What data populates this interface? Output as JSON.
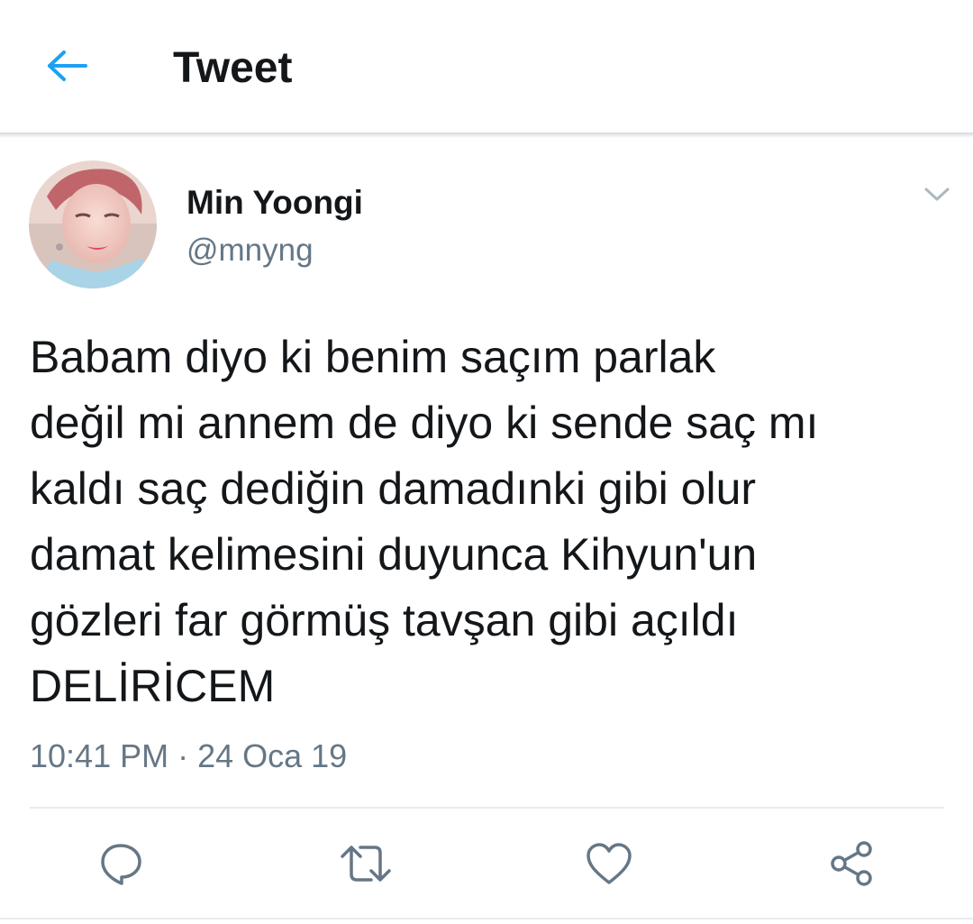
{
  "appbar": {
    "title": "Tweet",
    "back_icon": "back-arrow-icon",
    "accent_color": "#1da1f2"
  },
  "author": {
    "name": "Min Yoongi",
    "handle": "@mnyng",
    "menu_icon": "chevron-down-icon"
  },
  "tweet": {
    "text": "Babam diyo ki benim saçım parlak\ndeğil mi annem de diyo ki sende saç mı\nkaldı saç dediğin damadınki gibi olur\ndamat kelimesini duyunca Kihyun'un\ngözleri far görmüş tavşan gibi açıldı\nDELİRİCEM",
    "timestamp": "10:41 PM · 24 Oca 19"
  },
  "actions": {
    "reply_icon": "reply-icon",
    "retweet_icon": "retweet-icon",
    "like_icon": "heart-icon",
    "share_icon": "share-icon",
    "icon_color": "#657786"
  }
}
